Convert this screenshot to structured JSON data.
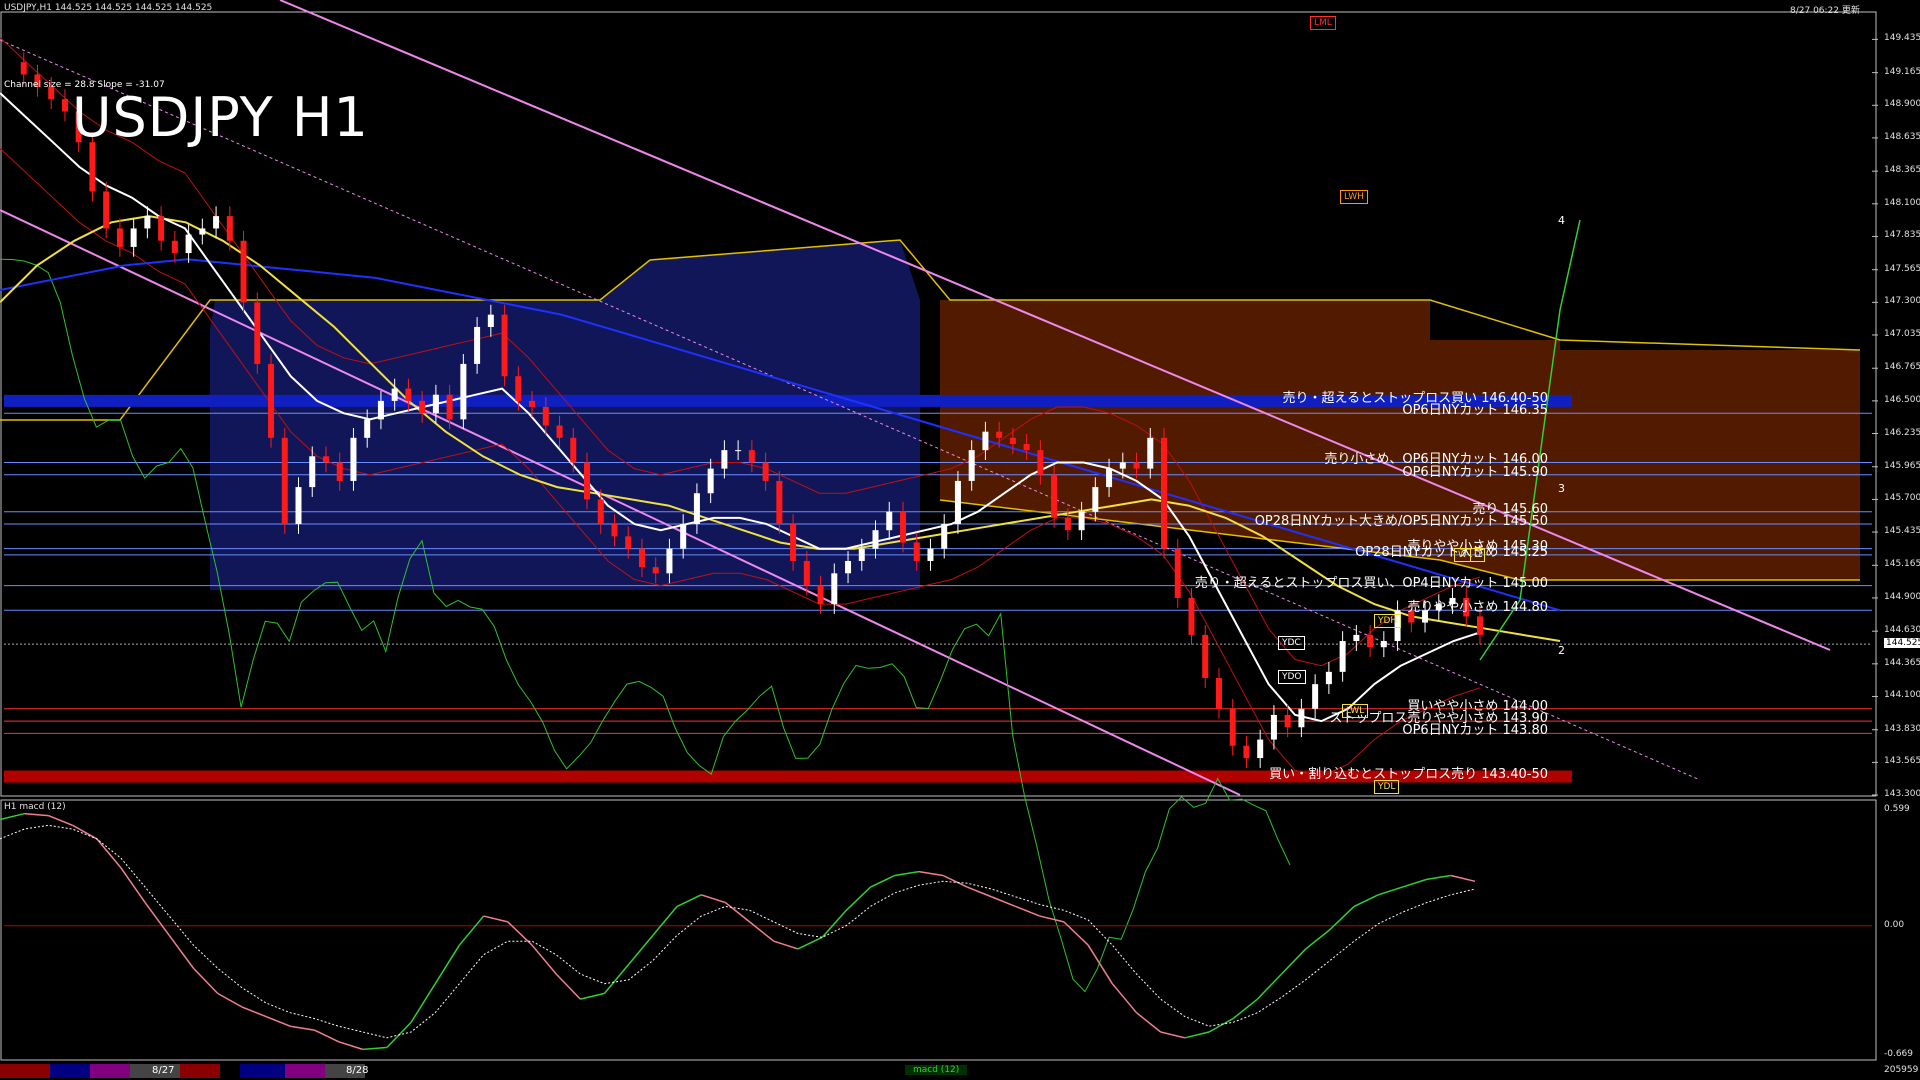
{
  "header": {
    "symbol_info": "USDJPY,H1  144.525 144.525 144.525 144.525",
    "datetime": "8/27 06:22 更新",
    "main_title": "USDJPY H1",
    "channel_info": "Channel size = 28.8 Slope = -31.07",
    "macd_title": "H1 macd (12)"
  },
  "colors": {
    "background": "#000000",
    "bull_candle": "#ffffff",
    "bear_candle": "#ff1a1a",
    "ma_white": "#ffffff",
    "ma_yellow": "#f0e040",
    "ma_blue": "#2030ff",
    "channel": "#ee88ee",
    "kumo_blue": "#3040ff",
    "kumo_orange": "#ff5500",
    "chikou": "#30c030",
    "macd_up": "#30d030",
    "macd_down": "#f08090",
    "signal": "#ffffff"
  },
  "chart_data": {
    "type": "line",
    "title": "USDJPY H1",
    "ylim": [
      143.3,
      149.43
    ],
    "y_ticks": [
      "149.435",
      "149.165",
      "148.900",
      "148.635",
      "148.365",
      "148.100",
      "147.835",
      "147.565",
      "147.300",
      "147.035",
      "146.765",
      "146.500",
      "146.235",
      "145.965",
      "145.700",
      "145.435",
      "145.165",
      "144.900",
      "144.630",
      "144.365",
      "144.100",
      "143.830",
      "143.565",
      "143.300"
    ],
    "current_price_label": "144.525",
    "close_series": [
      149.25,
      149.15,
      149.05,
      148.95,
      148.85,
      148.6,
      148.2,
      147.9,
      147.75,
      147.9,
      148.0,
      147.8,
      147.7,
      147.85,
      147.9,
      148.0,
      147.8,
      147.3,
      146.8,
      146.2,
      145.5,
      145.8,
      146.05,
      146.0,
      145.85,
      146.2,
      146.35,
      146.5,
      146.6,
      146.5,
      146.4,
      146.55,
      146.35,
      146.8,
      147.1,
      147.2,
      146.7,
      146.5,
      146.45,
      146.3,
      146.2,
      146.0,
      145.7,
      145.5,
      145.4,
      145.3,
      145.15,
      145.1,
      145.3,
      145.5,
      145.75,
      145.95,
      146.1,
      146.1,
      146.0,
      145.85,
      145.5,
      145.2,
      145.0,
      144.85,
      145.1,
      145.2,
      145.3,
      145.45,
      145.6,
      145.35,
      145.2,
      145.3,
      145.5,
      145.85,
      146.1,
      146.25,
      146.2,
      146.15,
      146.1,
      145.9,
      145.55,
      145.45,
      145.6,
      145.8,
      145.95,
      146.0,
      145.95,
      146.2,
      145.3,
      144.9,
      144.6,
      144.25,
      144.0,
      143.7,
      143.6,
      143.75,
      143.95,
      143.85,
      144.0,
      144.2,
      144.3,
      144.55,
      144.6,
      144.5,
      144.55,
      144.8,
      144.7,
      144.8,
      144.85,
      144.9,
      144.75,
      144.6
    ],
    "ma_white": [
      149.0,
      148.8,
      148.6,
      148.4,
      148.25,
      148.15,
      148.0,
      147.9,
      147.6,
      147.3,
      147.0,
      146.7,
      146.5,
      146.4,
      146.35,
      146.4,
      146.45,
      146.5,
      146.55,
      146.6,
      146.4,
      146.15,
      145.9,
      145.65,
      145.5,
      145.45,
      145.5,
      145.55,
      145.55,
      145.5,
      145.4,
      145.3,
      145.3,
      145.35,
      145.4,
      145.45,
      145.5,
      145.6,
      145.75,
      145.9,
      146.0,
      146.0,
      145.95,
      145.85,
      145.7,
      145.4,
      145.0,
      144.6,
      144.2,
      143.95,
      143.9,
      144.0,
      144.2,
      144.35,
      144.45,
      144.55,
      144.62
    ],
    "ma_yellow": [
      147.3,
      147.6,
      147.8,
      147.95,
      148.0,
      147.95,
      147.8,
      147.6,
      147.35,
      147.1,
      146.8,
      146.5,
      146.25,
      146.05,
      145.9,
      145.8,
      145.75,
      145.7,
      145.65,
      145.55,
      145.45,
      145.35,
      145.3,
      145.3,
      145.35,
      145.4,
      145.45,
      145.5,
      145.55,
      145.6,
      145.65,
      145.7,
      145.65,
      145.55,
      145.4,
      145.2,
      145.0,
      144.85,
      144.75,
      144.7,
      144.65,
      144.6,
      144.55
    ],
    "ma_blue": [
      147.4,
      147.5,
      147.6,
      147.65,
      147.6,
      147.55,
      147.5,
      147.4,
      147.3,
      147.2,
      147.05,
      146.9,
      146.75,
      146.6,
      146.45,
      146.3,
      146.15,
      146.0,
      145.85,
      145.7,
      145.55,
      145.4,
      145.25,
      145.1,
      144.95,
      144.8
    ],
    "levels": [
      {
        "price": 146.5,
        "text": "売り・超えるとストップロス買い 146.40-50",
        "color": "#1020c0",
        "thick": true
      },
      {
        "price": 146.4,
        "text": "OP6日NYカット 146.35",
        "color": "#6a8cff"
      },
      {
        "price": 146.0,
        "text": "売り小さめ、OP6日NYカット 146.00",
        "color": "#6a8cff"
      },
      {
        "price": 145.9,
        "text": "OP6日NYカット 145.90",
        "color": "#6a8cff"
      },
      {
        "price": 145.6,
        "text": "売り 145.60",
        "color": "#6a8cff"
      },
      {
        "price": 145.5,
        "text": "OP28日NYカット大きめ/OP5日NYカット 145.50",
        "color": "#6a8cff"
      },
      {
        "price": 145.3,
        "text": "売りやや小さめ 145.30",
        "color": "#6a8cff"
      },
      {
        "price": 145.25,
        "text": "OP28日NYカット大きめ 145.25",
        "color": "#6a8cff"
      },
      {
        "price": 145.0,
        "text": "売り・超えるとストップロス買い、OP4日NYカット 145.00",
        "color": "#6a8cff"
      },
      {
        "price": 144.8,
        "text": "売りやや小さめ 144.80",
        "color": "#6a8cff"
      },
      {
        "price": 144.0,
        "text": "買いやや小さめ 144.00",
        "color": "#ff3030"
      },
      {
        "price": 143.9,
        "text": "ストップロス売りやや小さめ 143.90",
        "color": "#ff3030"
      },
      {
        "price": 143.8,
        "text": "OP6日NYカット 143.80",
        "color": "#ff3030"
      },
      {
        "price": 143.45,
        "text": "買い・割り込むとストップロス売り 143.40-50",
        "color": "#b00000",
        "thick": true
      }
    ],
    "tags": [
      {
        "text": "LML",
        "color": "#ff3030"
      },
      {
        "text": "LWH",
        "color": "#ff9900"
      },
      {
        "text": "YDC",
        "color": "#ffffff"
      },
      {
        "text": "YDO",
        "color": "#ffffff"
      },
      {
        "text": "YDH",
        "color": "#f0e040"
      },
      {
        "text": "LWL",
        "color": "#f0e040"
      },
      {
        "text": "YDL",
        "color": "#f0e040"
      },
      {
        "text": "W",
        "color": "#f0e040"
      },
      {
        "text": "D",
        "color": "#f0e040"
      }
    ],
    "wave_labels": [
      "4",
      "3",
      "2"
    ],
    "macd": {
      "ylim": [
        -0.669,
        0.599
      ],
      "y_ticks": [
        "0.599",
        "0.00",
        "-0.669"
      ],
      "macd_series": [
        0.55,
        0.58,
        0.57,
        0.52,
        0.45,
        0.3,
        0.12,
        -0.05,
        -0.22,
        -0.35,
        -0.42,
        -0.47,
        -0.52,
        -0.54,
        -0.6,
        -0.64,
        -0.63,
        -0.5,
        -0.3,
        -0.1,
        0.05,
        0.02,
        -0.1,
        -0.25,
        -0.38,
        -0.35,
        -0.2,
        -0.05,
        0.1,
        0.16,
        0.12,
        0.02,
        -0.08,
        -0.12,
        -0.06,
        0.08,
        0.2,
        0.26,
        0.28,
        0.26,
        0.2,
        0.15,
        0.1,
        0.05,
        0.02,
        -0.1,
        -0.3,
        -0.45,
        -0.55,
        -0.58,
        -0.55,
        -0.48,
        -0.38,
        -0.25,
        -0.12,
        -0.02,
        0.1,
        0.16,
        0.2,
        0.24,
        0.26,
        0.23
      ],
      "signal_series": [
        0.45,
        0.5,
        0.52,
        0.5,
        0.45,
        0.35,
        0.2,
        0.05,
        -0.1,
        -0.22,
        -0.32,
        -0.4,
        -0.45,
        -0.48,
        -0.52,
        -0.55,
        -0.58,
        -0.55,
        -0.45,
        -0.3,
        -0.15,
        -0.08,
        -0.08,
        -0.15,
        -0.25,
        -0.3,
        -0.28,
        -0.18,
        -0.05,
        0.05,
        0.1,
        0.08,
        0.02,
        -0.04,
        -0.06,
        0.0,
        0.1,
        0.17,
        0.21,
        0.23,
        0.22,
        0.19,
        0.15,
        0.11,
        0.08,
        0.03,
        -0.1,
        -0.25,
        -0.38,
        -0.47,
        -0.52,
        -0.5,
        -0.45,
        -0.37,
        -0.28,
        -0.18,
        -0.08,
        0.01,
        0.07,
        0.12,
        0.16,
        0.19
      ]
    },
    "dates": [
      "8/27",
      "8/28"
    ]
  },
  "footer": {
    "tab_label": "macd (12)",
    "counter": "205959"
  }
}
